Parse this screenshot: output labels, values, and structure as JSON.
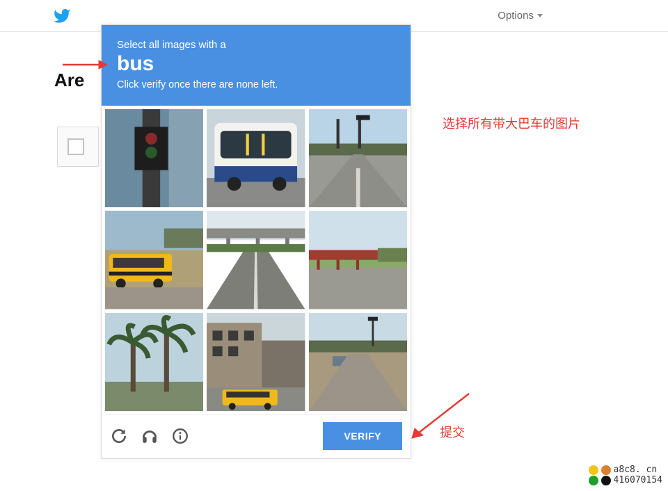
{
  "topbar": {
    "options_label": "Options"
  },
  "page": {
    "partial_title": "Are"
  },
  "captcha": {
    "instruction_line1": "Select all images with a",
    "target_word": "bus",
    "instruction_line2": "Click verify once there are none left.",
    "tiles": [
      {
        "name": "tile-1",
        "desc": "traffic light pole closeup"
      },
      {
        "name": "tile-2",
        "desc": "white and blue shuttle bus"
      },
      {
        "name": "tile-3",
        "desc": "empty intersection with traffic lights"
      },
      {
        "name": "tile-4",
        "desc": "yellow school bus on desert road"
      },
      {
        "name": "tile-5",
        "desc": "highway with overpass"
      },
      {
        "name": "tile-6",
        "desc": "road with red bridge"
      },
      {
        "name": "tile-7",
        "desc": "palm trees"
      },
      {
        "name": "tile-8",
        "desc": "urban building with yellow school bus"
      },
      {
        "name": "tile-9",
        "desc": "rural intersection with cars"
      }
    ],
    "verify_label": "VERIFY"
  },
  "annotations": {
    "select_hint": "选择所有带大巴车的图片",
    "submit_hint": "提交"
  },
  "watermark": {
    "line1": "a8c8. cn",
    "line2": "416070154"
  }
}
